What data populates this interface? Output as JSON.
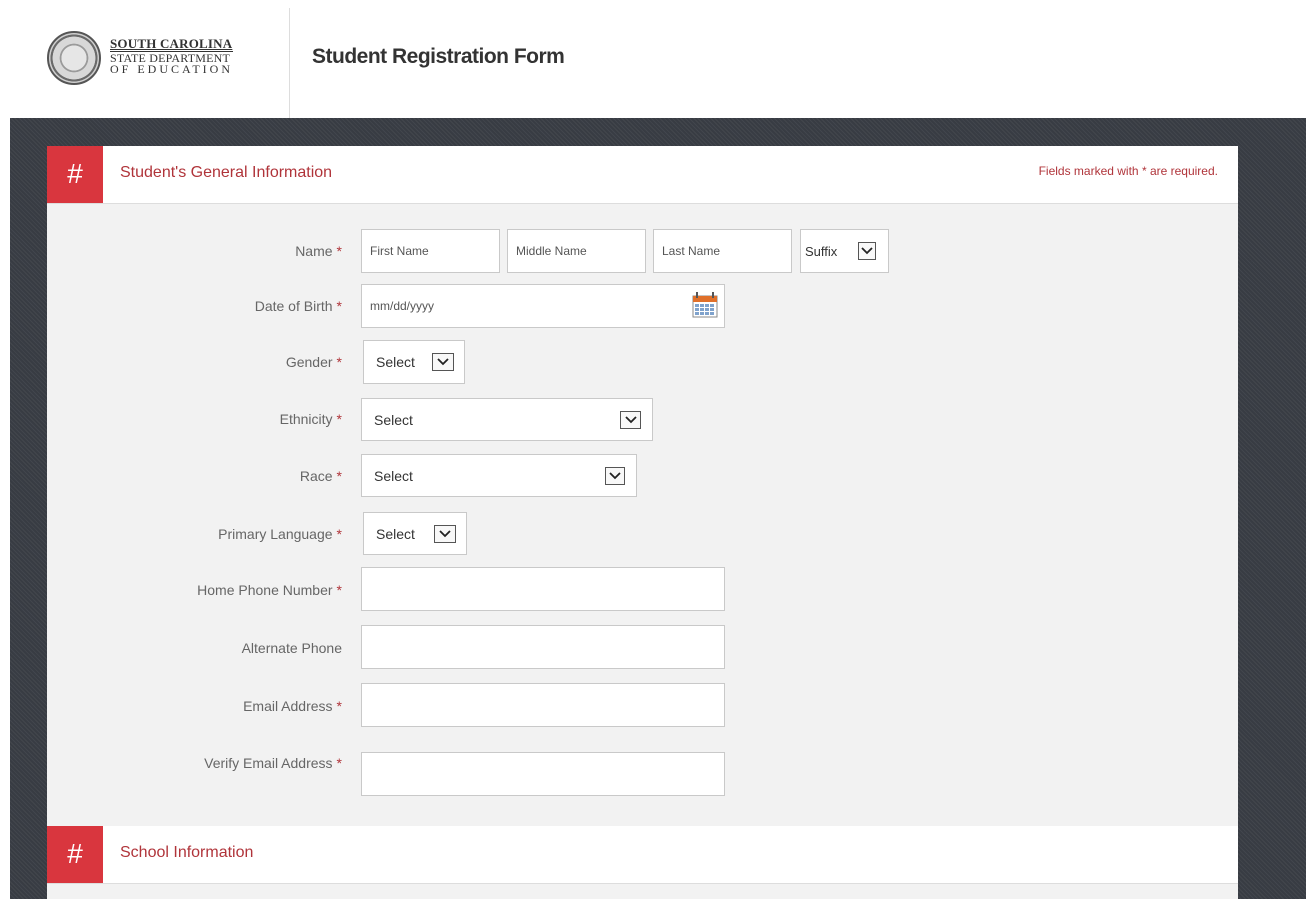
{
  "header": {
    "logo_line1": "SOUTH CAROLINA",
    "logo_line2": "STATE DEPARTMENT",
    "logo_line3": "OF EDUCATION",
    "title": "Student Registration Form"
  },
  "section1": {
    "hash": "#",
    "title": "Student's General Information",
    "required_note": "Fields marked with * are required."
  },
  "fields": {
    "name": {
      "label": "Name",
      "first_placeholder": "First Name",
      "middle_placeholder": "Middle Name",
      "last_placeholder": "Last Name",
      "suffix_value": "Suffix"
    },
    "dob": {
      "label": "Date of Birth",
      "placeholder": "mm/dd/yyyy"
    },
    "gender": {
      "label": "Gender",
      "value": "Select"
    },
    "ethnicity": {
      "label": "Ethnicity",
      "value": "Select"
    },
    "race": {
      "label": "Race",
      "value": "Select"
    },
    "language": {
      "label": "Primary Language",
      "value": "Select"
    },
    "home_phone": {
      "label": "Home Phone Number"
    },
    "alt_phone": {
      "label": "Alternate Phone"
    },
    "email": {
      "label": "Email Address"
    },
    "verify_email": {
      "label": "Verify Email Address"
    }
  },
  "required_star": "*",
  "section2": {
    "hash": "#",
    "title": "School Information"
  },
  "colors": {
    "accent": "#d9363e",
    "label_red": "#b0343a",
    "dark_bg": "#383c43",
    "panel_bg": "#f2f2f2"
  }
}
